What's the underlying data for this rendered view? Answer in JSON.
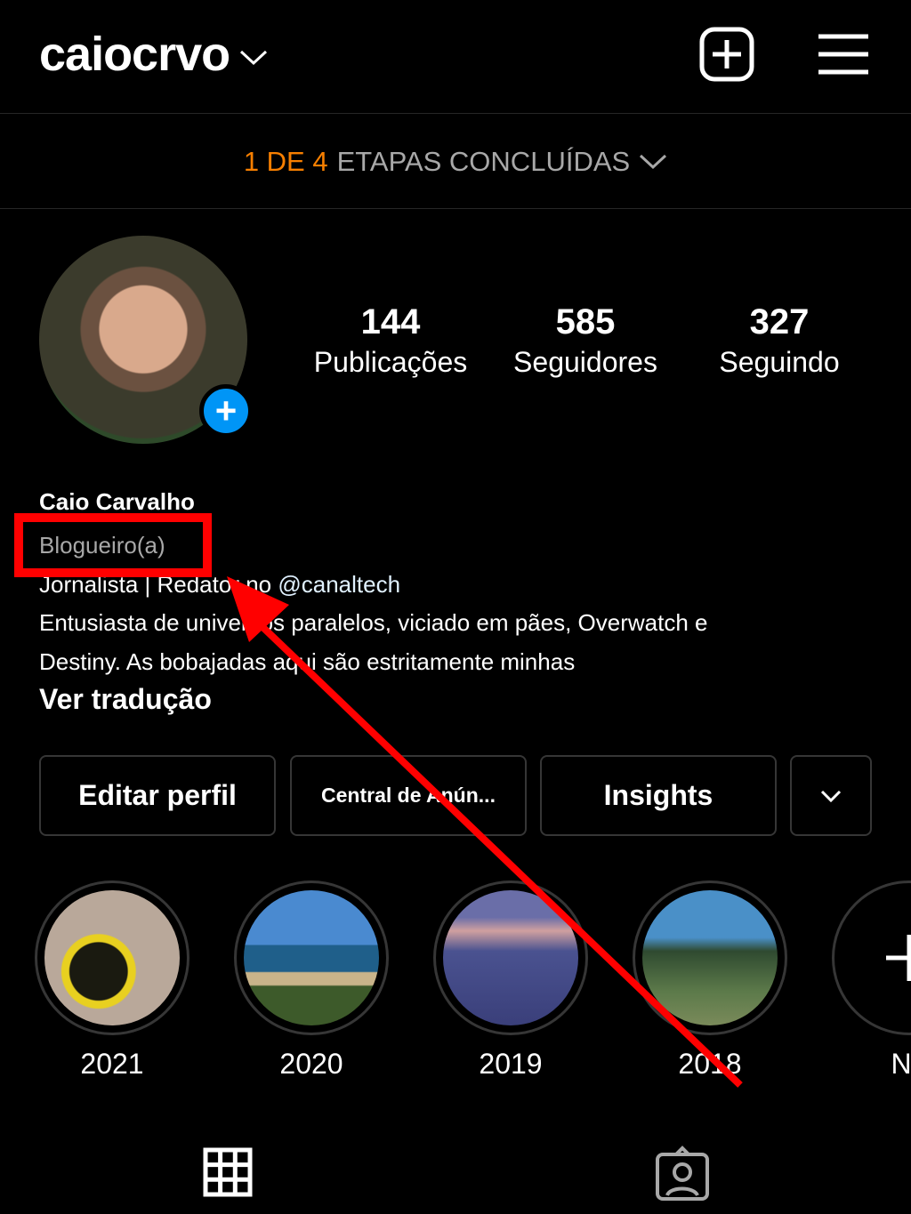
{
  "header": {
    "username": "caiocrvo",
    "new_post_icon": "plus-square-icon",
    "menu_icon": "hamburger-icon"
  },
  "steps": {
    "count": "1 DE 4",
    "label": "ETAPAS CONCLUÍDAS"
  },
  "profile": {
    "stats": [
      {
        "value": "144",
        "label": "Publicações"
      },
      {
        "value": "585",
        "label": "Seguidores"
      },
      {
        "value": "327",
        "label": "Seguindo"
      }
    ],
    "name": "Caio Carvalho",
    "category": "Blogueiro(a)",
    "bio_line1_prefix": "Jornalista | Redator no ",
    "bio_mention": "@canaltech",
    "bio_line2": "Entusiasta de universos paralelos, viciado em pães, Overwatch e",
    "bio_line3": "Destiny. As bobajadas aqui são estritamente minhas",
    "translate": "Ver tradução"
  },
  "buttons": {
    "edit": "Editar perfil",
    "ads": "Central de Anún...",
    "insights": "Insights"
  },
  "highlights": [
    {
      "label": "2021"
    },
    {
      "label": "2020"
    },
    {
      "label": "2019"
    },
    {
      "label": "2018"
    },
    {
      "label": "No"
    }
  ],
  "annotation": {
    "color": "#ff0000"
  }
}
